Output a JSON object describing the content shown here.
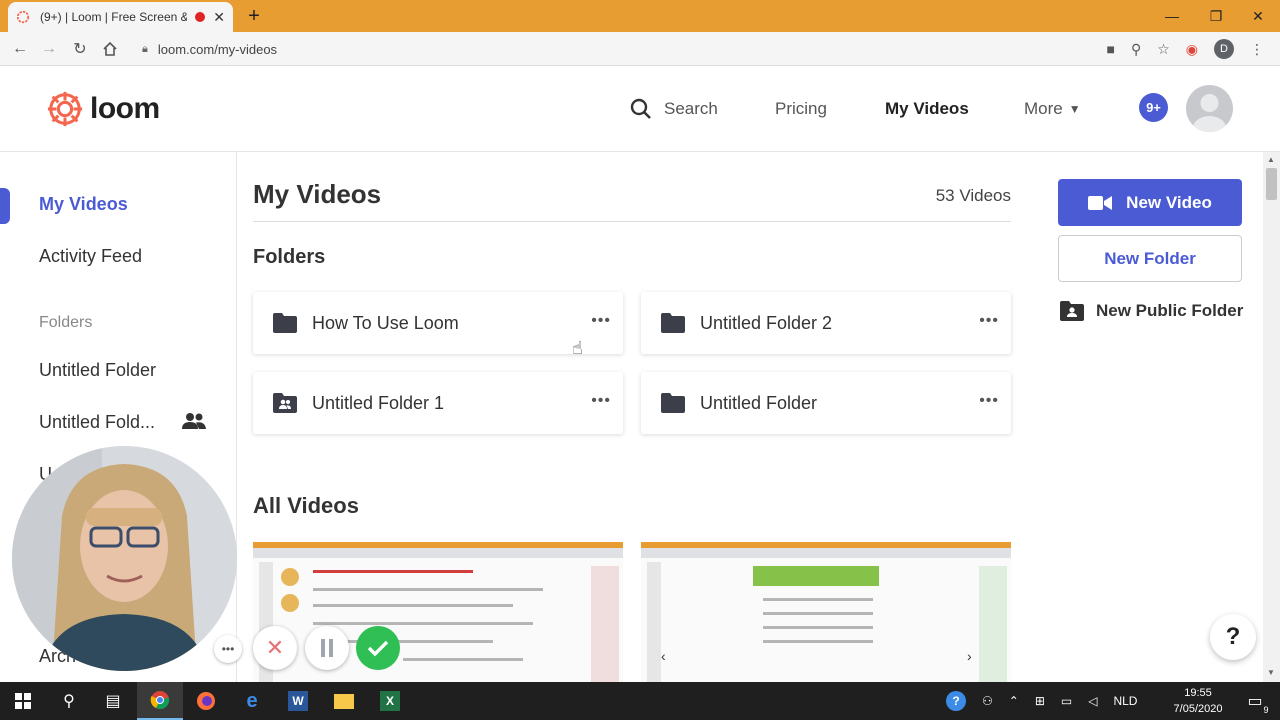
{
  "browser": {
    "tab_title": "(9+) | Loom | Free Screen & ",
    "tab_close": "✕",
    "new_tab": "+",
    "url": "loom.com/my-videos",
    "profile_letter": "D"
  },
  "header": {
    "logo_text": "loom",
    "search_label": "Search",
    "pricing_label": "Pricing",
    "myvideos_label": "My Videos",
    "more_label": "More",
    "notif_badge": "9+"
  },
  "sidebar": {
    "items": [
      {
        "label": "My Videos"
      },
      {
        "label": "Activity Feed"
      },
      {
        "label": "Folders"
      },
      {
        "label": "Untitled Folder"
      },
      {
        "label": "Untitled Fold..."
      },
      {
        "label": "U"
      },
      {
        "label": "Arch"
      }
    ]
  },
  "main": {
    "title": "My Videos",
    "video_count": "53 Videos",
    "folders_heading": "Folders",
    "folders": [
      {
        "name": "How To Use Loom",
        "shared": false
      },
      {
        "name": "Untitled Folder 2",
        "shared": false
      },
      {
        "name": "Untitled Folder 1",
        "shared": true
      },
      {
        "name": "Untitled Folder",
        "shared": false
      }
    ],
    "all_videos_heading": "All Videos"
  },
  "actions": {
    "new_video": "New Video",
    "new_folder": "New Folder",
    "new_public_folder": "New Public Folder"
  },
  "help": {
    "label": "?"
  },
  "taskbar": {
    "language": "NLD",
    "time": "19:55",
    "date": "7/05/2020",
    "notif_count": "9"
  },
  "colors": {
    "accent": "#4a5bd4",
    "tab_strip": "#e89d33",
    "done_green": "#2fbf55",
    "logo_red": "#f4674f"
  }
}
